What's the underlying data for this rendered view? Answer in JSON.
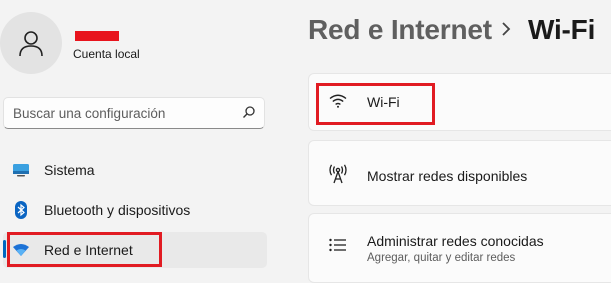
{
  "account": {
    "type_label": "Cuenta local",
    "avatar_icon": "person-icon"
  },
  "search": {
    "placeholder": "Buscar una configuración",
    "icon": "search-icon"
  },
  "sidebar": {
    "items": [
      {
        "label": "Sistema",
        "icon": "monitor-icon",
        "active": false
      },
      {
        "label": "Bluetooth y dispositivos",
        "icon": "bluetooth-icon",
        "active": false
      },
      {
        "label": "Red e Internet",
        "icon": "wifi-diamond-icon",
        "active": true
      }
    ]
  },
  "header": {
    "parent": "Red e Internet",
    "current": "Wi-Fi"
  },
  "cards": [
    {
      "title": "Wi-Fi",
      "icon": "wifi-icon"
    },
    {
      "title": "Mostrar redes disponibles",
      "icon": "antenna-icon"
    },
    {
      "title": "Administrar redes conocidas",
      "subtitle": "Agregar, quitar y editar redes",
      "icon": "list-icon"
    }
  ],
  "colors": {
    "accent": "#0067c0",
    "highlight": "#e11b22",
    "redaction": "#e8141d"
  }
}
